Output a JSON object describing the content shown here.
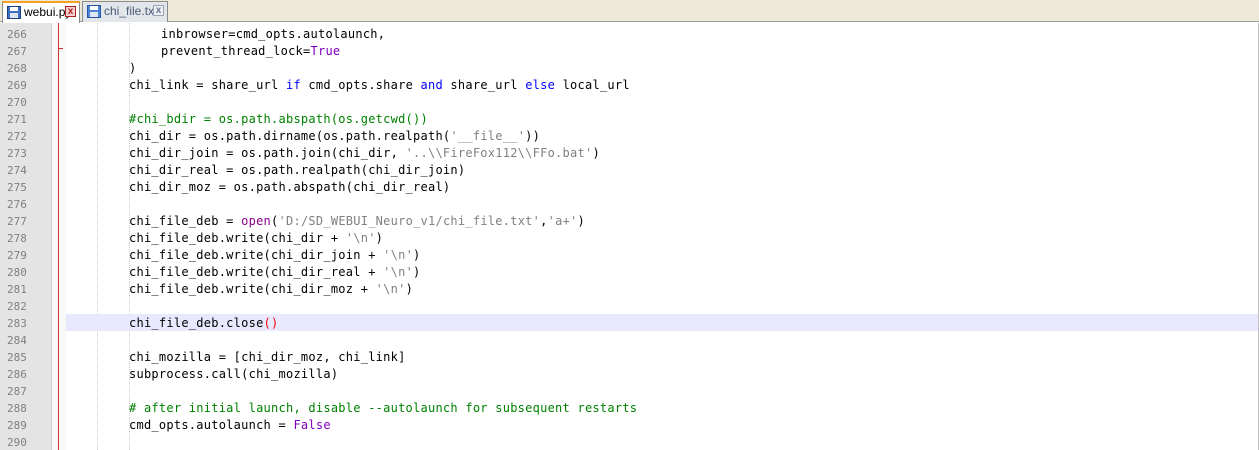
{
  "tabs": [
    {
      "label": "webui.py",
      "active": true,
      "icon": "floppy-disk-icon-saved",
      "close": "x"
    },
    {
      "label": "chi_file.txt",
      "active": false,
      "icon": "floppy-disk-icon",
      "close": "x"
    }
  ],
  "colors": {
    "keyword": "#0000ff",
    "constant": "#8000c0",
    "string": "#808080",
    "comment": "#008000",
    "current_line": "#e8e8ff",
    "brace_highlight": "#ff0000"
  },
  "lines": [
    {
      "num": "266",
      "segs": [
        [
          "t",
          "inbrowser=cmd_opts.autolaunch,"
        ]
      ]
    },
    {
      "num": "267",
      "segs": [
        [
          "t",
          "prevent_thread_lock="
        ],
        [
          "kw2",
          "True"
        ]
      ]
    },
    {
      "num": "268",
      "segs": [
        [
          "t",
          ")"
        ]
      ]
    },
    {
      "num": "269",
      "segs": [
        [
          "t",
          "chi_link = share_url "
        ],
        [
          "kw",
          "if"
        ],
        [
          "t",
          " cmd_opts.share "
        ],
        [
          "kw",
          "and"
        ],
        [
          "t",
          " share_url "
        ],
        [
          "kw",
          "else"
        ],
        [
          "t",
          " local_url"
        ]
      ]
    },
    {
      "num": "270",
      "segs": []
    },
    {
      "num": "271",
      "segs": [
        [
          "cmt",
          "#chi_bdir = os.path.abspath(os.getcwd())"
        ]
      ]
    },
    {
      "num": "272",
      "segs": [
        [
          "t",
          "chi_dir = os.path.dirname(os.path.realpath("
        ],
        [
          "str",
          "'__file__'"
        ],
        [
          "t",
          "))"
        ]
      ]
    },
    {
      "num": "273",
      "segs": [
        [
          "t",
          "chi_dir_join = os.path.join(chi_dir, "
        ],
        [
          "str",
          "'..\\\\FireFox112\\\\FFo.bat'"
        ],
        [
          "t",
          ")"
        ]
      ]
    },
    {
      "num": "274",
      "segs": [
        [
          "t",
          "chi_dir_real = os.path.realpath(chi_dir_join)"
        ]
      ]
    },
    {
      "num": "275",
      "segs": [
        [
          "t",
          "chi_dir_moz = os.path.abspath(chi_dir_real)"
        ]
      ]
    },
    {
      "num": "276",
      "segs": []
    },
    {
      "num": "277",
      "segs": [
        [
          "t",
          "chi_file_deb = "
        ],
        [
          "bi",
          "open"
        ],
        [
          "t",
          "("
        ],
        [
          "str",
          "'D:/SD_WEBUI_Neuro_v1/chi_file.txt'"
        ],
        [
          "t",
          ","
        ],
        [
          "str",
          "'a+'"
        ],
        [
          "t",
          ")"
        ]
      ]
    },
    {
      "num": "278",
      "segs": [
        [
          "t",
          "chi_file_deb.write(chi_dir + "
        ],
        [
          "str",
          "'\\n'"
        ],
        [
          "t",
          ")"
        ]
      ]
    },
    {
      "num": "279",
      "segs": [
        [
          "t",
          "chi_file_deb.write(chi_dir_join + "
        ],
        [
          "str",
          "'\\n'"
        ],
        [
          "t",
          ")"
        ]
      ]
    },
    {
      "num": "280",
      "segs": [
        [
          "t",
          "chi_file_deb.write(chi_dir_real + "
        ],
        [
          "str",
          "'\\n'"
        ],
        [
          "t",
          ")"
        ]
      ]
    },
    {
      "num": "281",
      "segs": [
        [
          "t",
          "chi_file_deb.write(chi_dir_moz + "
        ],
        [
          "str",
          "'\\n'"
        ],
        [
          "t",
          ")"
        ]
      ]
    },
    {
      "num": "282",
      "segs": []
    },
    {
      "num": "283",
      "segs": [
        [
          "t",
          "chi_file_deb.close"
        ],
        [
          "brace",
          "()"
        ]
      ],
      "current": true
    },
    {
      "num": "284",
      "segs": []
    },
    {
      "num": "285",
      "segs": [
        [
          "t",
          "chi_mozilla = [chi_dir_moz, chi_link]"
        ]
      ]
    },
    {
      "num": "286",
      "segs": [
        [
          "t",
          "subprocess.call(chi_mozilla)"
        ]
      ]
    },
    {
      "num": "287",
      "segs": []
    },
    {
      "num": "288",
      "segs": [
        [
          "cmt",
          "# after initial launch, disable --autolaunch for subsequent restarts"
        ]
      ]
    },
    {
      "num": "289",
      "segs": [
        [
          "t",
          "cmd_opts.autolaunch = "
        ],
        [
          "kw2",
          "False"
        ]
      ]
    },
    {
      "num": "290",
      "segs": []
    }
  ]
}
